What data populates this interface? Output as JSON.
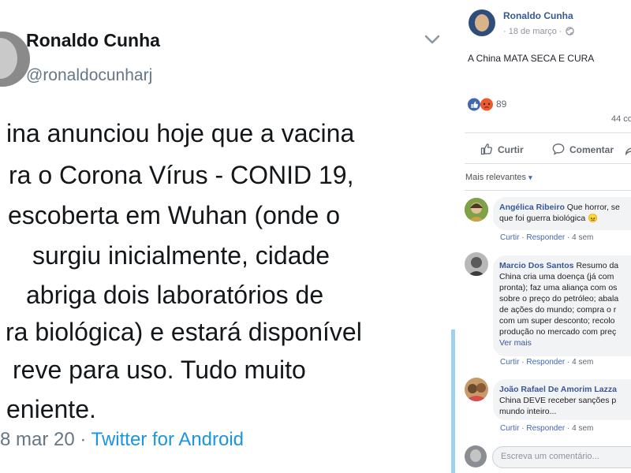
{
  "tweet": {
    "name": "Ronaldo Cunha",
    "handle": "@ronaldocunharj",
    "lines": [
      "ina anunciou hoje que a vacina",
      "ra o Corona Vírus - CONID 19,",
      "escoberta em Wuhan (onde o",
      "surgiu inicialmente, cidade",
      "abriga dois laboratórios de",
      "ra biológica) e estará disponível",
      "reve para uso. Tudo muito",
      "eniente."
    ],
    "meta_date": "8 mar 20 · ",
    "meta_source": "Twitter for Android"
  },
  "facebook": {
    "author": "Ronaldo Cunha",
    "date": "· 18 de março ·",
    "post_text": "A China MATA SECA E CURA",
    "reactions_count": "89",
    "comments_count": "44 co",
    "actions": {
      "like": "Curtir",
      "comment": "Comentar"
    },
    "filter": {
      "label": "Mais relevantes",
      "arrow": "▾"
    },
    "comments": [
      {
        "author": "Angélica Ribeiro",
        "text": " Que horror, se",
        "text2": "que foi guerra biológica 😠",
        "actions": [
          "Curtir",
          "Responder",
          "4 sem"
        ]
      },
      {
        "author": "Marcio Dos Santos",
        "text": " Resumo da",
        "lines": [
          "China cria uma doença (já com",
          "pronta); faz uma aliança com os",
          "sobre o preço do petróleo; abala",
          "de ações do mundo; compra o r",
          "com um super desconto; recolo",
          "produção no mercado com preç"
        ],
        "more": "Ver mais",
        "actions": [
          "Curtir",
          "Responder",
          "4 sem"
        ]
      },
      {
        "author": "João Rafael De Amorim Lazza",
        "lines": [
          "China DEVE receber sanções p",
          "mundo inteiro..."
        ],
        "actions": [
          "Curtir",
          "Responder",
          "4 sem"
        ]
      }
    ],
    "compose_placeholder": "Escreva um comentário..."
  },
  "colors": {
    "twitter_blue": "#1b95e0",
    "facebook_blue": "#365899",
    "like_blue": "#4267b2",
    "angry_orange": "#f0582c"
  }
}
